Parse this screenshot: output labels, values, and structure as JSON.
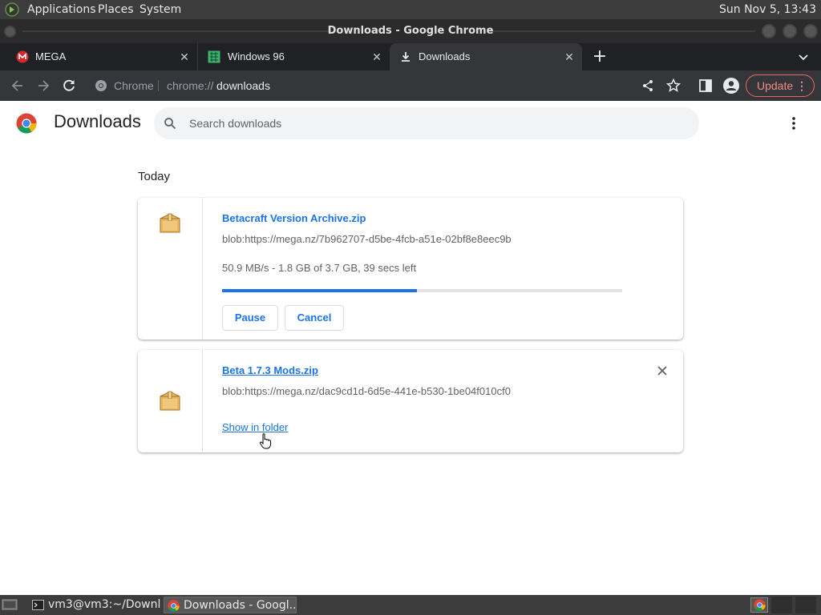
{
  "top_panel": {
    "menus": [
      "Applications",
      "Places",
      "System"
    ],
    "clock": "Sun Nov  5, 13:43"
  },
  "window": {
    "title": "Downloads - Google Chrome"
  },
  "tabs": [
    {
      "label": "MEGA",
      "icon": "mega-icon",
      "active": false
    },
    {
      "label": "Windows 96",
      "icon": "windows96-icon",
      "active": false
    },
    {
      "label": "Downloads",
      "icon": "download-icon",
      "active": true
    }
  ],
  "toolbar": {
    "site_chip": "Chrome",
    "url_scheme": "chrome://",
    "url_path": "downloads",
    "update_label": "Update"
  },
  "page": {
    "title": "Downloads",
    "search_placeholder": "Search downloads",
    "section": "Today",
    "downloads": [
      {
        "file_name": "Betacraft Version Archive.zip",
        "url": "blob:https://mega.nz/7b962707-d5be-4fcb-a51e-02bf8e8eec9b",
        "status": "50.9 MB/s - 1.8 GB of 3.7 GB, 39 secs left",
        "progress": 0.4865,
        "actions": [
          "Pause",
          "Cancel"
        ]
      },
      {
        "file_name": "Beta 1.7.3 Mods.zip",
        "url": "blob:https://mega.nz/dac9cd1d-6d5e-441e-b530-1be04f010cf0",
        "link": "Show in folder"
      }
    ]
  },
  "taskbar": {
    "tasks": [
      {
        "label": "vm3@vm3:~/Downl...",
        "icon": "terminal-icon"
      },
      {
        "label": "Downloads - Googl...",
        "icon": "chrome-icon",
        "active": true
      }
    ]
  },
  "colors": {
    "accent": "#1a73e8",
    "update_accent": "#f28b82",
    "panel_bg": "#3c3c3c",
    "tab_bg": "#202124",
    "toolbar_bg": "#35363a"
  }
}
